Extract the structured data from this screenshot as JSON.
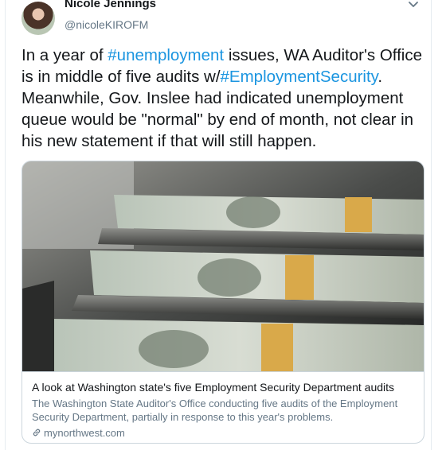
{
  "tweet": {
    "author_name": "Nicole Jennings",
    "author_handle": "@nicoleKIROFM",
    "text_parts": {
      "p1": "In a year of ",
      "tag1": "#unemployment",
      "p2": " issues, WA Auditor's Office is in middle of five audits w/",
      "tag2": "#EmploymentSecurity",
      "p3": ". Meanwhile, Gov. Inslee had indicated unemployment queue would be \"normal\" by end of month, not clear in his new statement if that will still happen."
    }
  },
  "card": {
    "title": "A look at Washington state's five Employment Security Department audits",
    "description": "The Washington State Auditor's Office conducting five audits of the Employment Security Department, partially in response to this year's problems.",
    "domain": "mynorthwest.com",
    "image_description_icon": "link-icon"
  },
  "colors": {
    "hashtag": "#1b95e0",
    "secondary_text": "#657786",
    "border": "#ccd6dd"
  }
}
